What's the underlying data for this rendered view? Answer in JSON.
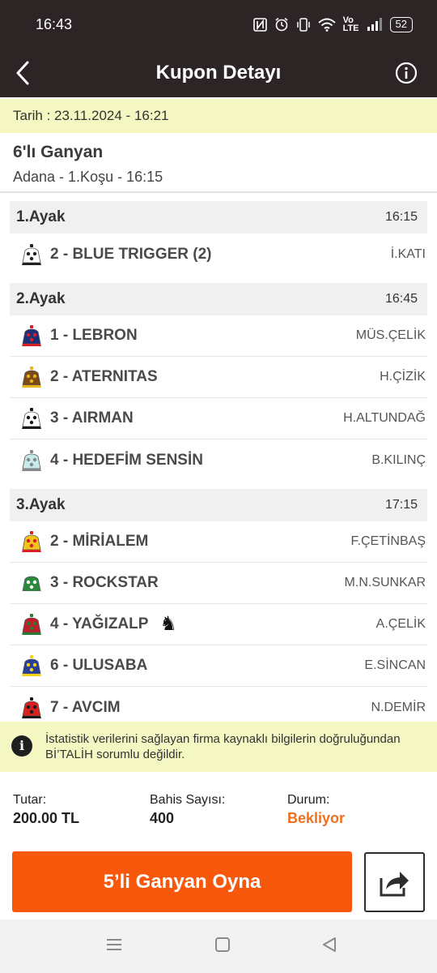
{
  "status_bar": {
    "time": "16:43",
    "battery": "52",
    "icons": [
      "nfc-icon",
      "alarm-icon",
      "vibrate-icon",
      "wifi-icon",
      "volte-icon",
      "signal-icon",
      "battery-icon"
    ],
    "volte_top": "Vo",
    "volte_bottom": "LTE"
  },
  "header": {
    "title": "Kupon Detayı"
  },
  "coupon": {
    "date": "Tarih : 23.11.2024 - 16:21",
    "type": "6'lı Ganyan",
    "race": "Adana - 1.Koşu - 16:15"
  },
  "legs": [
    {
      "name": "1.Ayak",
      "time": "16:15",
      "horses": [
        {
          "name": "2 - BLUE TRIGGER (2)",
          "jockey": "İ.KATI",
          "silk": [
            "#ffffff",
            "#222222"
          ]
        }
      ]
    },
    {
      "name": "2.Ayak",
      "time": "16:45",
      "horses": [
        {
          "name": "1 - LEBRON",
          "jockey": "MÜS.ÇELİK",
          "silk": [
            "#1e2f7a",
            "#d81f26"
          ]
        },
        {
          "name": "2 - ATERNITAS",
          "jockey": "H.ÇİZİK",
          "silk": [
            "#7b4a14",
            "#e7b41e"
          ]
        },
        {
          "name": "3 - AIRMAN",
          "jockey": "H.ALTUNDAĞ",
          "silk": [
            "#ffffff",
            "#1a1a1a"
          ]
        },
        {
          "name": "4 - HEDEFİM SENSİN",
          "jockey": "B.KILINÇ",
          "silk": [
            "#c6e9ea",
            "#888888"
          ]
        }
      ]
    },
    {
      "name": "3.Ayak",
      "time": "17:15",
      "horses": [
        {
          "name": "2 - MİRİALEM",
          "jockey": "F.ÇETİNBAŞ",
          "silk": [
            "#f3c41b",
            "#d81f26"
          ]
        },
        {
          "name": "3 - ROCKSTAR",
          "jockey": "M.N.SUNKAR",
          "silk": [
            "#2a8a3c",
            "#ffffff"
          ]
        },
        {
          "name": "4 - YAĞIZALP",
          "jockey": "A.ÇELİK",
          "silk": [
            "#c01f2a",
            "#2a7a36"
          ],
          "favorite_icon": "♞"
        },
        {
          "name": "6 - ULUSABA",
          "jockey": "E.SİNCAN",
          "silk": [
            "#2a3e9a",
            "#f2d41a"
          ]
        },
        {
          "name": "7 - AVCIM",
          "jockey": "N.DEMİR",
          "silk": [
            "#d82020",
            "#1a1a1a"
          ]
        }
      ]
    }
  ],
  "notice": {
    "icon": "i",
    "text": "İstatistik verilerini sağlayan firma kaynaklı bilgilerin doğruluğundan Bİ’TALİH sorumlu değildir."
  },
  "summary": {
    "amount_label": "Tutar:",
    "amount_value": "200.00 TL",
    "bets_label": "Bahis Sayısı:",
    "bets_value": "400",
    "status_label": "Durum:",
    "status_value": "Bekliyor"
  },
  "actions": {
    "play_label": "5’li Ganyan Oyna",
    "share_icon": "share-icon"
  },
  "colors": {
    "header_bg": "#2d2426",
    "accent": "#f8580c",
    "status": "#f26f1d",
    "notice_bg": "#f4f7c2"
  }
}
